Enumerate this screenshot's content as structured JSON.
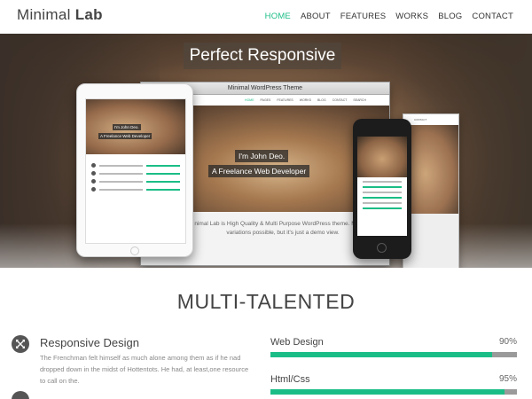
{
  "header": {
    "logo_light": "Minimal ",
    "logo_bold": "Lab",
    "nav": [
      "HOME",
      "ABOUT",
      "FEATURES",
      "WORKS",
      "BLOG",
      "CONTACT"
    ],
    "active_nav": "HOME"
  },
  "hero": {
    "title": "Perfect Responsive",
    "browser_title": "Minimal WordPress Theme",
    "browser_nav": [
      "HOME",
      "PAGES",
      "FEATURES",
      "WORKS",
      "BLOG",
      "CONTACT",
      "SEARCH"
    ],
    "tagline_1": "I'm John Deo.",
    "tagline_2": "A Freelance Web Developer",
    "description": "nimal Lab is High Quality & Multi Purpose WordPress theme. Multiple variations possible, but it's just a demo view."
  },
  "section": {
    "title": "MULTI-TALENTED"
  },
  "feature": {
    "title": "Responsive Design",
    "description": "The Frenchman felt himself as much alone among them as if he nad dropped down in the midst of Hottentots. He had, at least,one resource to call on the."
  },
  "skills": [
    {
      "name": "Web Design",
      "percent_label": "90%",
      "value": 0.9
    },
    {
      "name": "Html/Css",
      "percent_label": "95%",
      "value": 0.95
    }
  ],
  "colors": {
    "accent": "#1bbd87",
    "track": "#9a9a9a"
  }
}
